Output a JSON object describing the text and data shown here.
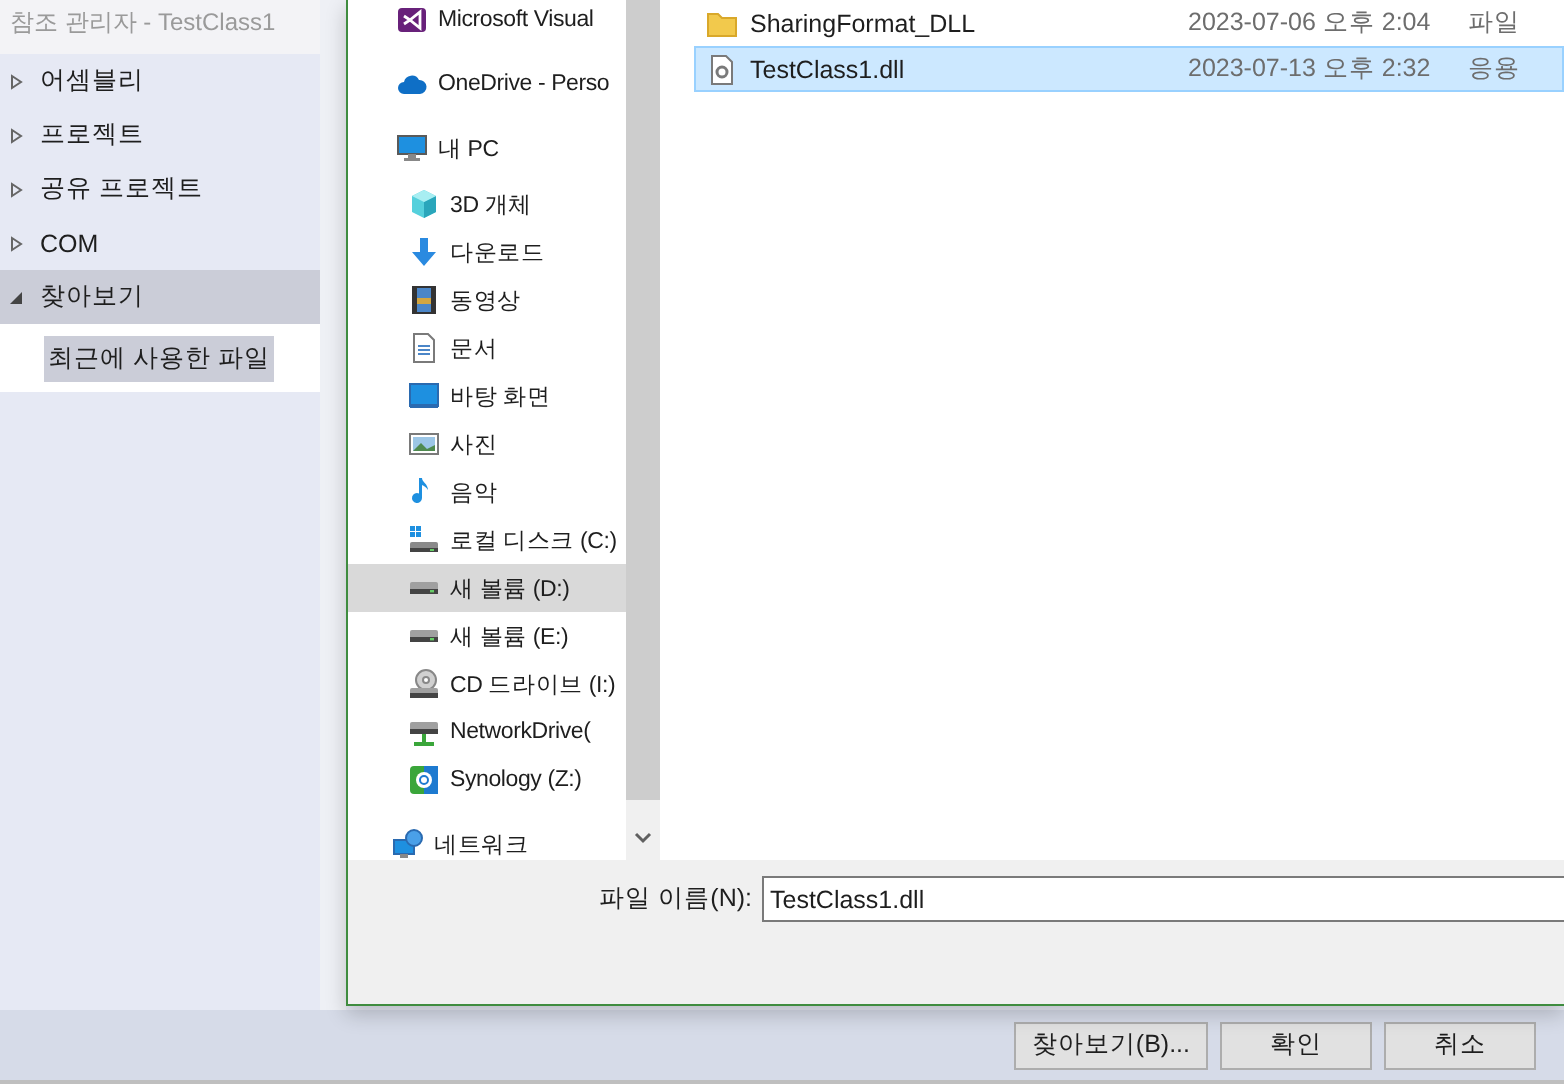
{
  "window": {
    "title": "참조 관리자 - TestClass1"
  },
  "sidebar": {
    "items": [
      {
        "label": "어셈블리",
        "expanded": false,
        "selected": false
      },
      {
        "label": "프로젝트",
        "expanded": false,
        "selected": false
      },
      {
        "label": "공유 프로젝트",
        "expanded": false,
        "selected": false
      },
      {
        "label": "COM",
        "expanded": false,
        "selected": false
      },
      {
        "label": "찾아보기",
        "expanded": true,
        "selected": true,
        "children": [
          {
            "label": "최근에 사용한 파일",
            "selected": true
          }
        ]
      }
    ]
  },
  "file_dialog": {
    "nav_items": [
      {
        "label": "Microsoft Visual",
        "kind": "app",
        "selected": false
      },
      {
        "label": "OneDrive - Perso",
        "kind": "cloud",
        "selected": false
      },
      {
        "label": "내 PC",
        "kind": "pc",
        "selected": false,
        "children": [
          {
            "label": "3D 개체",
            "kind": "cube",
            "selected": false
          },
          {
            "label": "다운로드",
            "kind": "download",
            "selected": false
          },
          {
            "label": "동영상",
            "kind": "video",
            "selected": false
          },
          {
            "label": "문서",
            "kind": "document",
            "selected": false
          },
          {
            "label": "바탕 화면",
            "kind": "desktop",
            "selected": false
          },
          {
            "label": "사진",
            "kind": "picture",
            "selected": false
          },
          {
            "label": "음악",
            "kind": "music",
            "selected": false
          },
          {
            "label": "로컬 디스크 (C:)",
            "kind": "system-drive",
            "selected": false
          },
          {
            "label": "새 볼륨 (D:)",
            "kind": "drive",
            "selected": true
          },
          {
            "label": "새 볼륨 (E:)",
            "kind": "drive",
            "selected": false
          },
          {
            "label": "CD 드라이브 (I:)",
            "kind": "cd-drive",
            "selected": false
          },
          {
            "label": "NetworkDrive(",
            "kind": "network-drive",
            "selected": false
          },
          {
            "label": "Synology (Z:)",
            "kind": "nas",
            "selected": false
          }
        ]
      },
      {
        "label": "네트워크",
        "kind": "network",
        "selected": false
      }
    ],
    "files": [
      {
        "name": "SharingFormat_DLL",
        "modified": "2023-07-06 오후 2:04",
        "type": "파일",
        "kind": "folder",
        "selected": false
      },
      {
        "name": "TestClass1.dll",
        "modified": "2023-07-13 오후 2:32",
        "type": "응용",
        "kind": "dll",
        "selected": true
      }
    ],
    "file_name": {
      "label": "파일 이름(N):",
      "value": "TestClass1.dll"
    }
  },
  "buttons": [
    {
      "label": "찾아보기(B)..."
    },
    {
      "label": "확인"
    },
    {
      "label": "취소"
    }
  ]
}
